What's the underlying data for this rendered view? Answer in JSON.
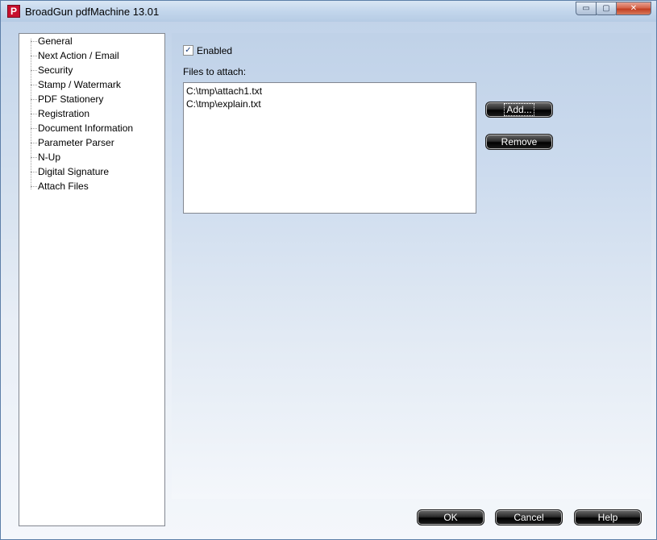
{
  "window": {
    "title": "BroadGun pdfMachine 13.01",
    "icon_letter": "P",
    "controls": {
      "minimize": "▭",
      "maximize": "▢",
      "close": "✕"
    }
  },
  "tree": {
    "items": [
      {
        "label": "General"
      },
      {
        "label": "Next Action / Email"
      },
      {
        "label": "Security"
      },
      {
        "label": "Stamp / Watermark"
      },
      {
        "label": "PDF Stationery"
      },
      {
        "label": "Registration"
      },
      {
        "label": "Document Information"
      },
      {
        "label": "Parameter Parser"
      },
      {
        "label": "N-Up"
      },
      {
        "label": "Digital Signature"
      },
      {
        "label": "Attach Files"
      }
    ],
    "selected": "Attach Files"
  },
  "attach": {
    "enabled_label": "Enabled",
    "enabled_checked": true,
    "check_glyph": "✓",
    "files_label": "Files to attach:",
    "files": [
      "C:\\tmp\\attach1.txt",
      "C:\\tmp\\explain.txt"
    ],
    "add_label": "Add...",
    "remove_label": "Remove"
  },
  "footer": {
    "ok_label": "OK",
    "cancel_label": "Cancel",
    "help_label": "Help"
  }
}
